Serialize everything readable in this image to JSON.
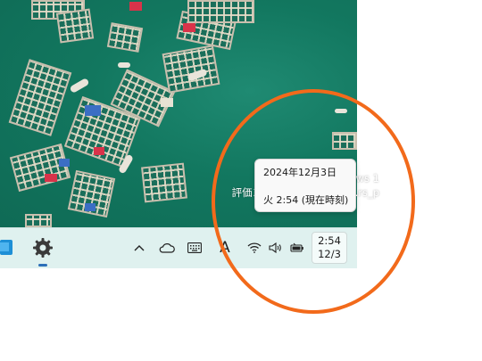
{
  "desktop": {
    "watermark_line1": "Windows 1",
    "watermark_line2": "評価コピー。Build 27754.rs_p"
  },
  "taskbar": {
    "icons": [
      "windows-app-icon",
      "settings-gear-icon",
      "chevron-up-icon",
      "onedrive-cloud-icon",
      "keyboard-icon",
      "input-indicator",
      "wifi-icon",
      "volume-icon",
      "battery-icon"
    ],
    "input_indicator_label": "A",
    "clock": {
      "time": "2:54",
      "date": "12/3"
    }
  },
  "tooltip": {
    "date_full": "2024年12月3日",
    "time_current": "火 2:54 (現在時刻)"
  },
  "colors": {
    "annotation": "#f26a1b",
    "taskbar": "#dff1ef",
    "sea": "#12775f"
  }
}
